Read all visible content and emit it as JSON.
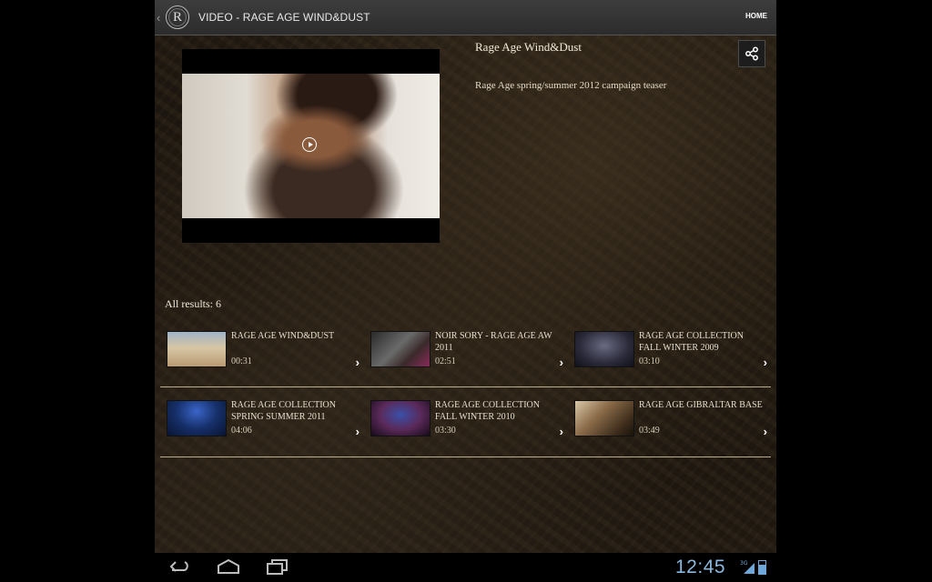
{
  "header": {
    "back": "‹",
    "logo_letter": "R",
    "title": "VIDEO - RAGE AGE WIND&DUST",
    "home_label": "HOME"
  },
  "video": {
    "title": "Rage Age Wind&Dust",
    "description": "Rage Age spring/summer 2012 campaign teaser",
    "share_icon": "share-icon"
  },
  "results": {
    "label": "All results: 6",
    "items": [
      {
        "title": "RAGE AGE WIND&DUST",
        "duration": "00:31",
        "thumb_color": "#c9b28e"
      },
      {
        "title": "NOIR SORY - RAGE AGE AW 2011",
        "duration": "02:51",
        "thumb_color": "#4a4a4a"
      },
      {
        "title": "RAGE AGE COLLECTION FALL WINTER 2009",
        "duration": "03:10",
        "thumb_color": "#3a3a52"
      },
      {
        "title": "RAGE AGE COLLECTION SPRING SUMMER 2011",
        "duration": "04:06",
        "thumb_color": "#223a7a"
      },
      {
        "title": "RAGE AGE COLLECTION FALL WINTER 2010",
        "duration": "03:30",
        "thumb_color": "#5a2a4a"
      },
      {
        "title": "RAGE AGE GIBRALTAR BASE",
        "duration": "03:49",
        "thumb_color": "#8a6a48"
      }
    ]
  },
  "system": {
    "time": "12:45",
    "network": "3G",
    "accent": "#8ab8de"
  }
}
